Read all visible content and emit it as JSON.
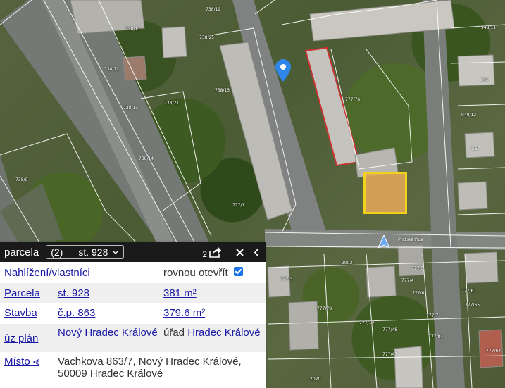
{
  "map": {
    "parcel_labels": [
      "738/11",
      "738/12",
      "738/25",
      "738/19",
      "738/15",
      "738/21",
      "738/14",
      "738/13",
      "738/9",
      "777/1",
      "777/76",
      "777/48",
      "777/47",
      "777/3",
      "777/4",
      "777/78",
      "777/19",
      "777/84",
      "541",
      "567",
      "777/67",
      "777/65",
      "777/64",
      "777/5",
      "777/6",
      "777/7",
      "2003",
      "2020",
      "948/11",
      "940/12"
    ],
    "street_label": "Pražská třída",
    "pin_icon": "location-pin-icon",
    "arrow_icon": "navigation-arrow-icon"
  },
  "panel": {
    "title": "parcela",
    "selector": {
      "count": "(2)",
      "value": "st. 928"
    },
    "badge": "2",
    "icons": {
      "share": "share-icon",
      "close": "close-icon",
      "collapse": "chevron-left-icon"
    },
    "rows": {
      "ownership": {
        "label": "Nahlížení/vlastníci",
        "open_text": "rovnou otevřít",
        "checked": true
      },
      "parcel": {
        "label": "Parcela",
        "number": "st. 928",
        "area": "381 m²"
      },
      "building": {
        "label": "Stavba",
        "number": "č.p. 863",
        "area": "379.6 m²"
      },
      "land_registry": {
        "label": "úz plán",
        "value": "Nový Hradec Králové",
        "office_prefix": "úřad",
        "office": "Hradec Králové"
      },
      "place": {
        "label": "Místo ⪡",
        "address": "Vachkova 863/7, Nový Hradec Králové, 50009 Hradec Králové"
      }
    }
  },
  "colors": {
    "header": "#1a1a1a",
    "link": "#1a1aa6",
    "accent": "#1a73e8",
    "parcel_fill": "#e6aa5a",
    "parcel_border": "#f2d11a"
  }
}
